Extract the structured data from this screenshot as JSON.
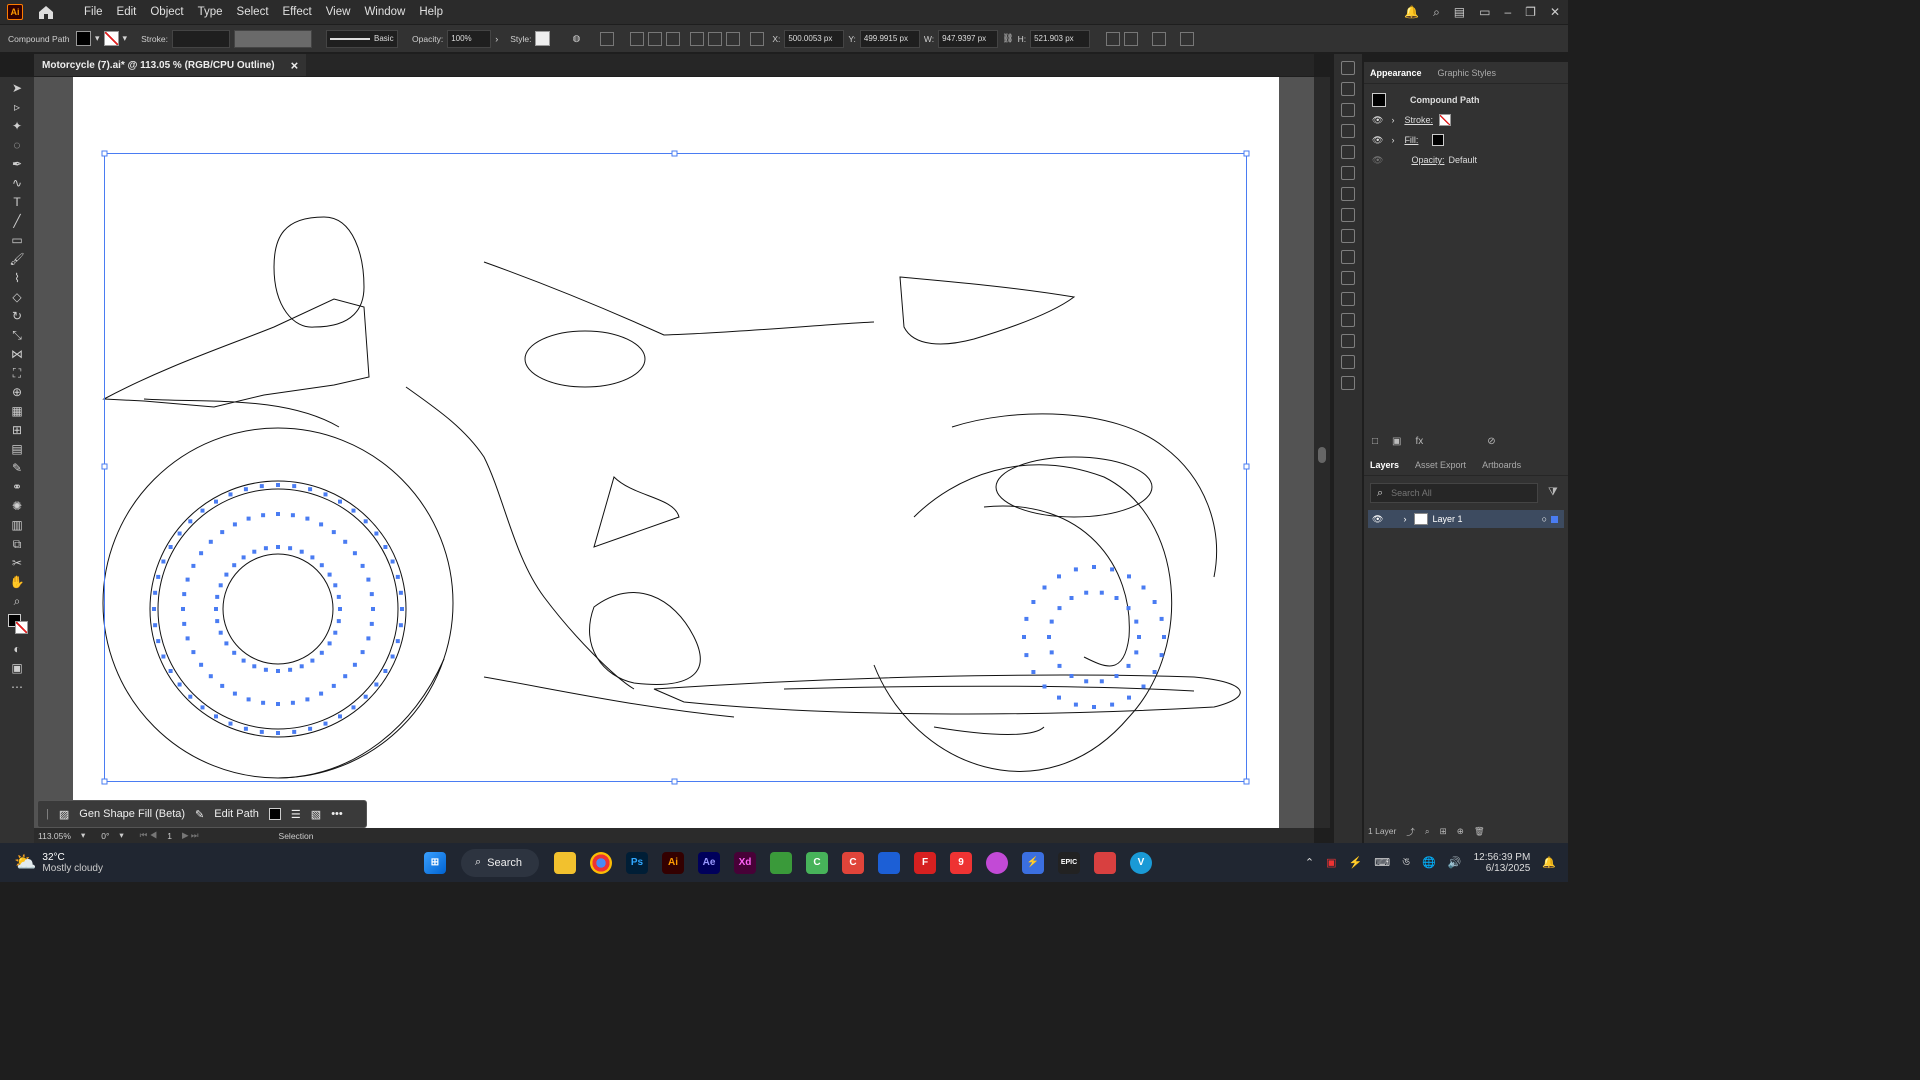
{
  "app": {
    "logo": "Ai"
  },
  "menu": [
    "File",
    "Edit",
    "Object",
    "Type",
    "Select",
    "Effect",
    "View",
    "Window",
    "Help"
  ],
  "control": {
    "selection_type": "Compound Path",
    "stroke_label": "Stroke:",
    "brush_label": "Basic",
    "opacity_label": "Opacity:",
    "opacity": "100%",
    "style_label": "Style:",
    "x_label": "X:",
    "x": "500.0053 px",
    "y_label": "Y:",
    "y": "499.9915 px",
    "w_label": "W:",
    "w": "947.9397 px",
    "h_label": "H:",
    "h": "521.903 px"
  },
  "document": {
    "tab_title": "Motorcycle (7).ai* @ 113.05 % (RGB/CPU Outline)",
    "close": "×"
  },
  "context_bar": {
    "gen_fill": "Gen Shape Fill (Beta)",
    "edit_path": "Edit Path",
    "more": "•••"
  },
  "status": {
    "zoom": "113.05%",
    "rotation": "0°",
    "artboard": "1",
    "tool": "Selection"
  },
  "appearance": {
    "tabs": [
      "Appearance",
      "Graphic Styles"
    ],
    "title": "Compound Path",
    "stroke": "Stroke:",
    "fill": "Fill:",
    "opacity_label": "Opacity:",
    "opacity_value": "Default"
  },
  "layers": {
    "tabs": [
      "Layers",
      "Asset Export",
      "Artboards"
    ],
    "search_placeholder": "Search All",
    "layer_name": "Layer 1",
    "count": "1 Layer"
  },
  "taskbar": {
    "weather_temp": "32°C",
    "weather_desc": "Mostly cloudy",
    "search": "Search",
    "time": "12:56:39 PM",
    "date": "6/13/2025"
  },
  "colors": {
    "selection": "#4a7cf2",
    "accent": "#ff9a00"
  }
}
